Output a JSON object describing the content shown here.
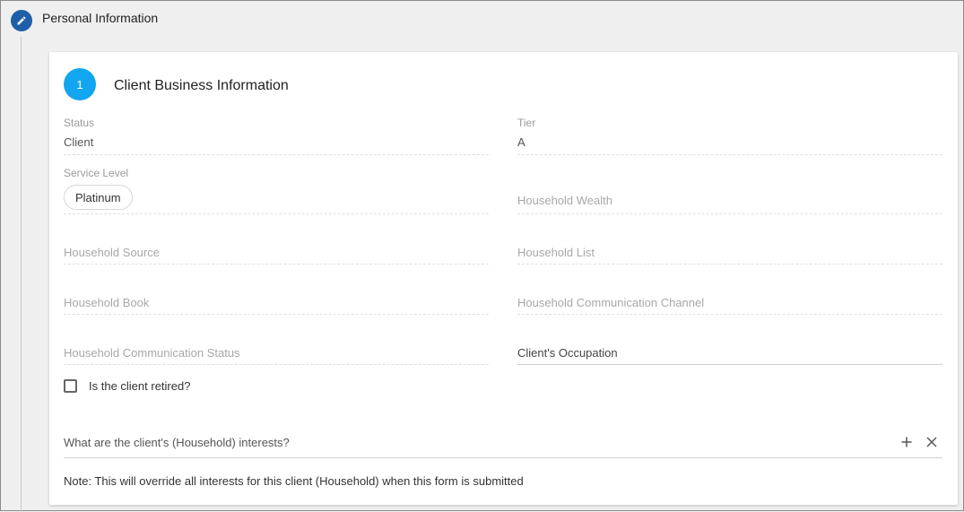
{
  "section": {
    "title": "Personal Information",
    "edit_icon": "pencil-icon"
  },
  "card": {
    "step_number": "1",
    "title": "Client Business Information"
  },
  "fields": {
    "status": {
      "label": "Status",
      "value": "Client"
    },
    "tier": {
      "label": "Tier",
      "value": "A"
    },
    "service_level": {
      "label": "Service Level",
      "value": "Platinum"
    },
    "household_wealth": {
      "placeholder": "Household Wealth"
    },
    "household_source": {
      "placeholder": "Household Source"
    },
    "household_list": {
      "placeholder": "Household List"
    },
    "household_book": {
      "placeholder": "Household Book"
    },
    "household_comm_channel": {
      "placeholder": "Household Communication Channel"
    },
    "household_comm_status": {
      "placeholder": "Household Communication Status"
    },
    "client_occupation": {
      "placeholder": "Client's Occupation"
    }
  },
  "retired": {
    "label": "Is the client retired?",
    "checked": false
  },
  "interests": {
    "label": "What are the client's (Household) interests?",
    "add_icon": "plus-icon",
    "clear_icon": "close-icon"
  },
  "note": "Note: This will override all interests for this client (Household) when this form is submitted"
}
